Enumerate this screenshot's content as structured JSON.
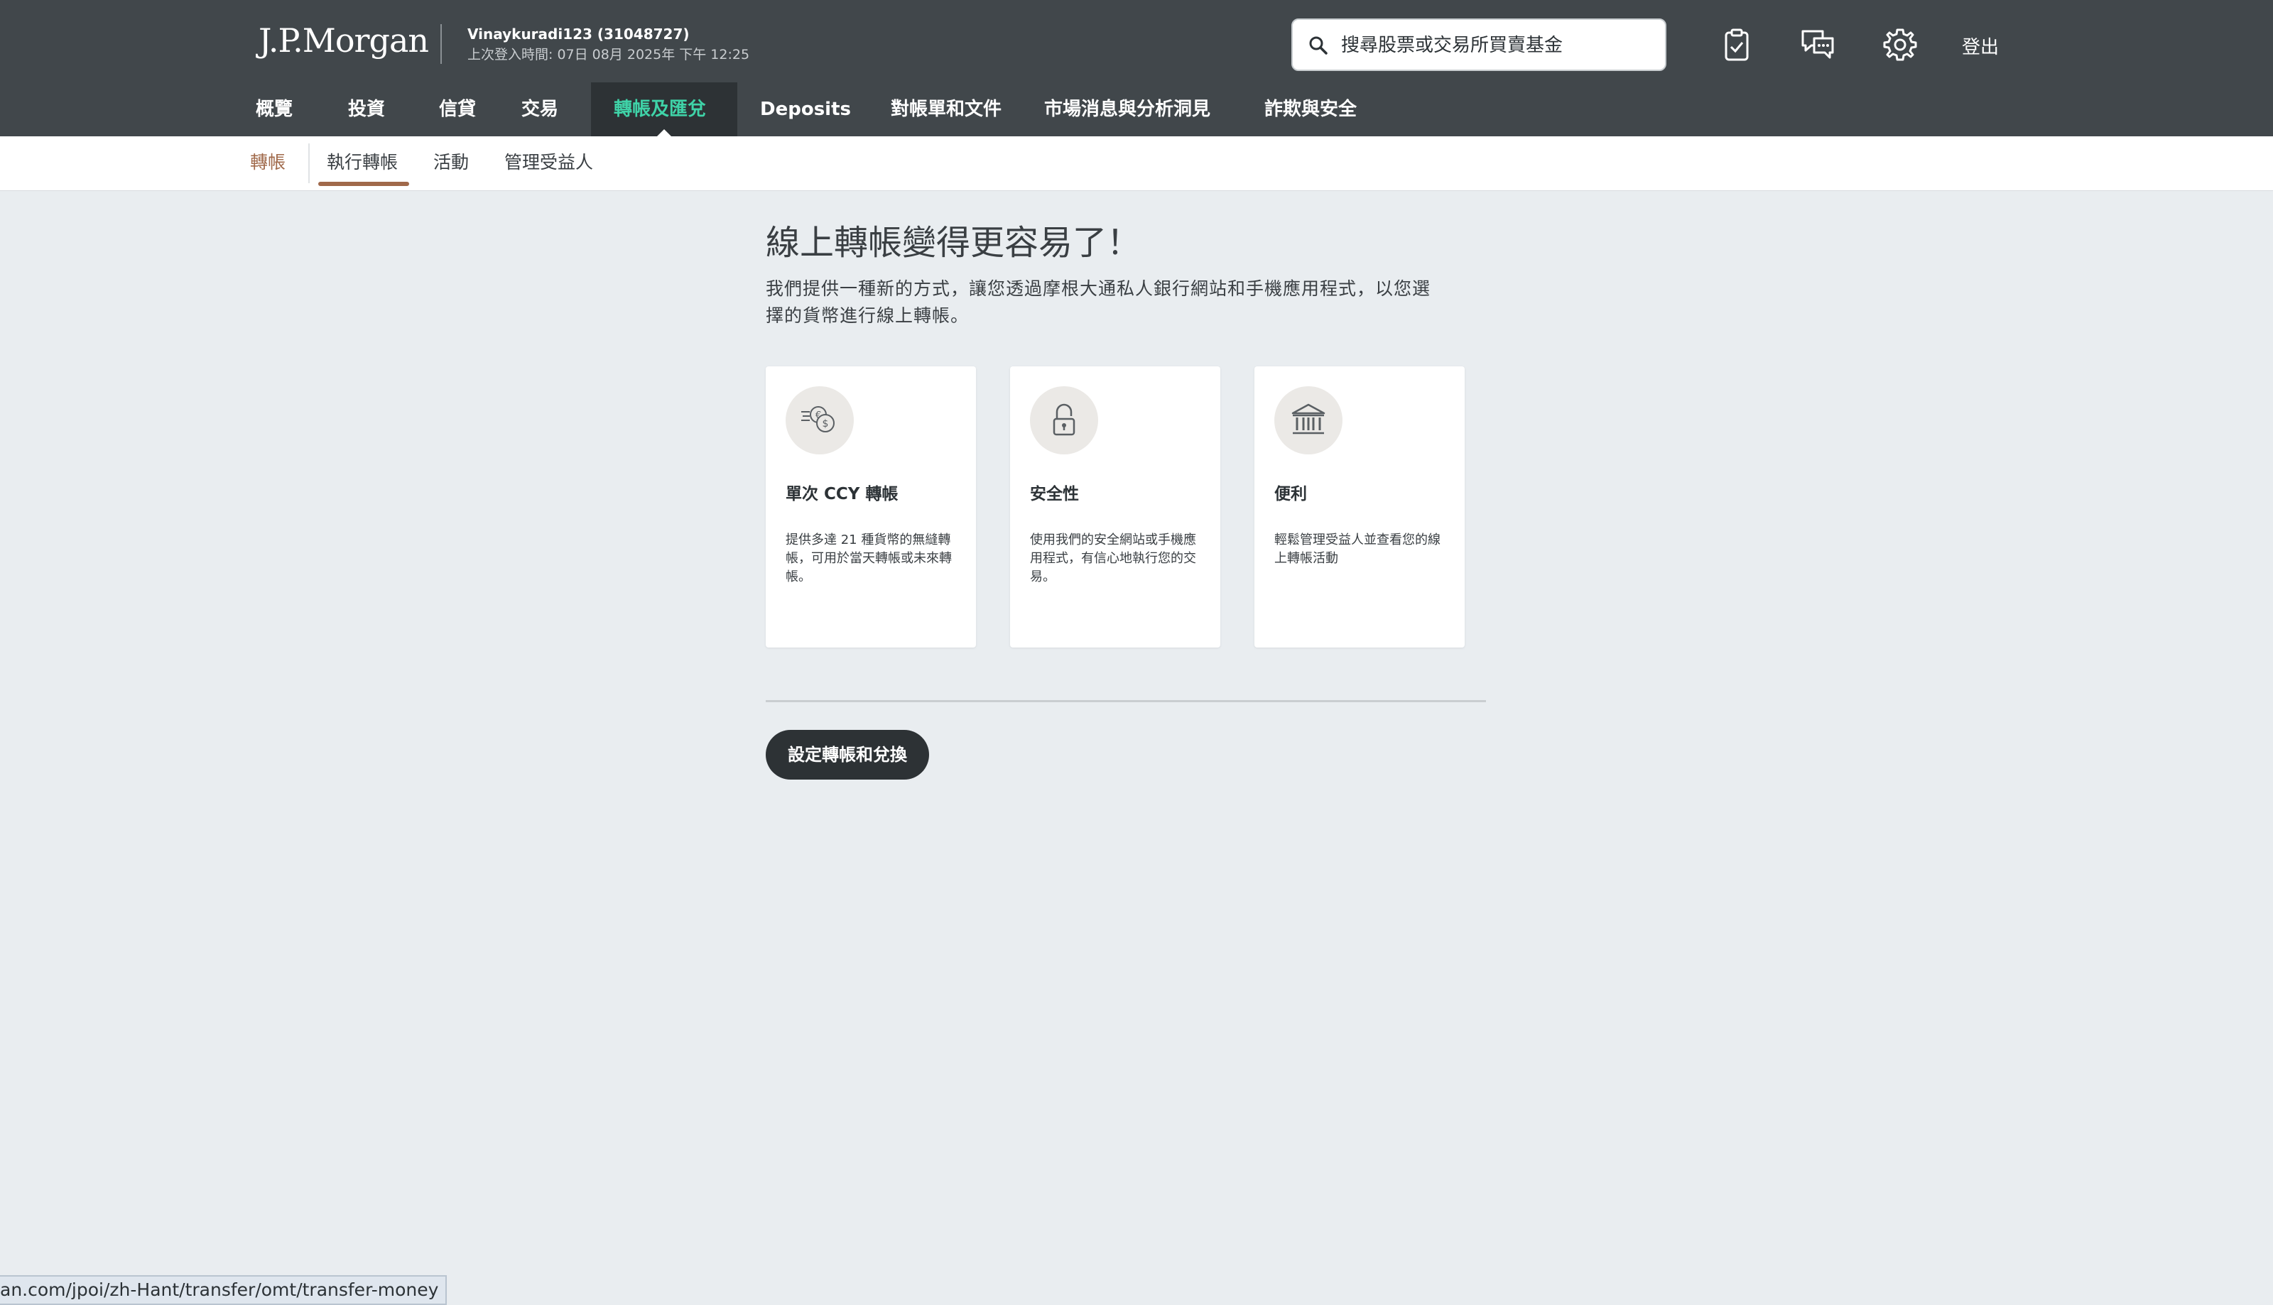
{
  "header": {
    "logo": "J.P.Morgan",
    "user_name": "Vinaykuradi123 (31048727)",
    "last_login": "上次登入時間: 07日 08月 2025年 下午 12:25",
    "search_placeholder": "搜尋股票或交易所買賣基金",
    "logout": "登出",
    "icons": [
      "clipboard-check-icon",
      "chat-icon",
      "gear-icon"
    ]
  },
  "nav": {
    "items": [
      {
        "label": "概覽"
      },
      {
        "label": "投資"
      },
      {
        "label": "信貸"
      },
      {
        "label": "交易"
      },
      {
        "label": "轉帳及匯兌",
        "active": true
      },
      {
        "label": "Deposits"
      },
      {
        "label": "對帳單和文件"
      },
      {
        "label": "市場消息與分析洞見"
      },
      {
        "label": "詐欺與安全"
      }
    ]
  },
  "subnav": {
    "root": "轉帳",
    "items": [
      {
        "label": "執行轉帳",
        "active": true
      },
      {
        "label": "活動"
      },
      {
        "label": "管理受益人"
      }
    ]
  },
  "content": {
    "headline": "線上轉帳變得更容易了！",
    "intro": "我們提供一種新的方式，讓您透過摩根大通私人銀行網站和手機應用程式，以您選擇的貨幣進行線上轉帳。",
    "cards": [
      {
        "icon": "currency-exchange-icon",
        "title": "單次 CCY 轉帳",
        "desc": "提供多達 21 種貨幣的無縫轉帳，可用於當天轉帳或未來轉帳。"
      },
      {
        "icon": "padlock-icon",
        "title": "安全性",
        "desc": "使用我們的安全網站或手機應用程式，有信心地執行您的交易。"
      },
      {
        "icon": "bank-icon",
        "title": "便利",
        "desc": "輕鬆管理受益人並查看您的線上轉帳活動"
      }
    ],
    "cta": "設定轉帳和兌換"
  },
  "statusbar": {
    "url": "an.com/jpoi/zh-Hant/transfer/omt/transfer-money"
  },
  "colors": {
    "header_bg": "#41474b",
    "active_nav_text": "#3fd3a8",
    "accent_underline": "#a0694a",
    "page_bg": "#e9edf0"
  }
}
